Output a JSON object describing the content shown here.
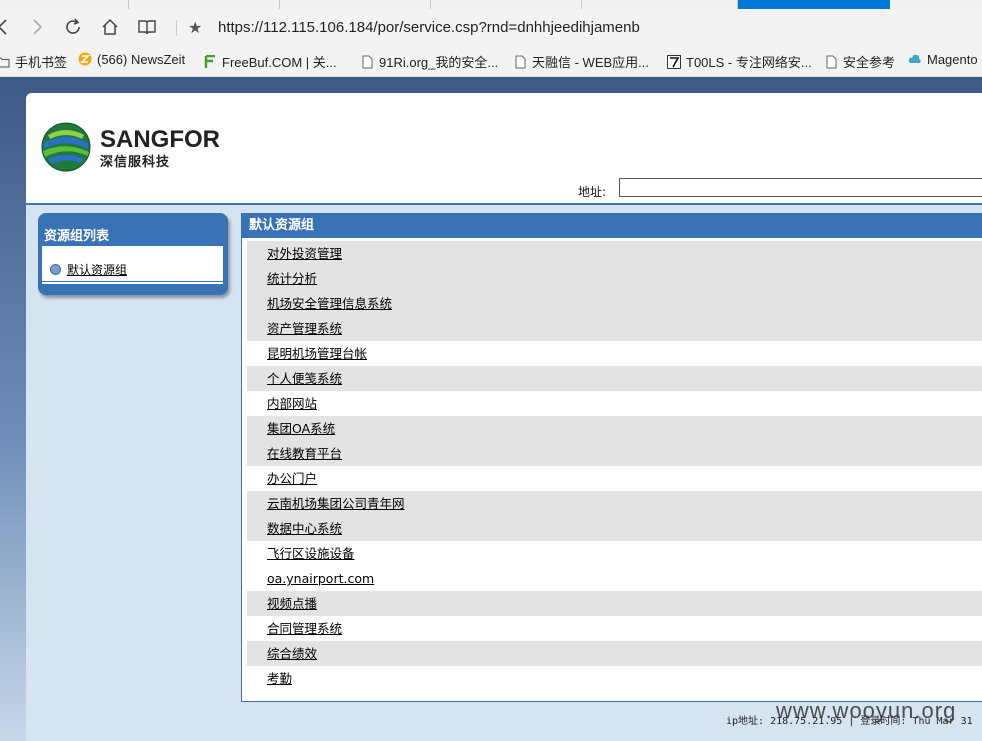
{
  "browser": {
    "url": "https://112.115.106.184/por/service.csp?rnd=dnhhjeedihjamenb",
    "bookmarks": [
      {
        "label": "手机书签",
        "icon": "folder-icon"
      },
      {
        "label": "(566) NewsZeit",
        "icon": "newszeit-icon"
      },
      {
        "label": "FreeBuf.COM | 关...",
        "icon": "freebuf-icon"
      },
      {
        "label": "91Ri.org_我的安全...",
        "icon": "page-icon"
      },
      {
        "label": "天融信 - WEB应用...",
        "icon": "page-icon"
      },
      {
        "label": "T00LS - 专注网络安...",
        "icon": "tools-icon"
      },
      {
        "label": "安全参考",
        "icon": "page-icon"
      },
      {
        "label": "Magento",
        "icon": "cloud-icon"
      }
    ]
  },
  "header": {
    "logo_text": "SANGFOR",
    "logo_sub": "深信服科技",
    "address_label": "地址:",
    "address_value": ""
  },
  "left_panel": {
    "title": "资源组列表",
    "items": [
      "默认资源组"
    ]
  },
  "right_panel": {
    "title": "默认资源组",
    "resources": [
      "对外投资管理",
      "统计分析",
      "机场安全管理信息系统",
      "资产管理系统",
      "昆明机场管理台帐",
      "个人便笺系统",
      "内部网站",
      "集团OA系统",
      "在线教育平台",
      "办公门户",
      "云南机场集团公司青年网",
      "数据中心系统",
      "飞行区设施设备",
      "oa.ynairport.com",
      "视频点播",
      "合同管理系统",
      "综合绩效",
      "考勤"
    ]
  },
  "footer": {
    "status": "ip地址: 218.75.21.95 | 登录时间: Thu Mar 31"
  },
  "watermark": "www.wooyun.org",
  "colors": {
    "accent": "#3a73b5",
    "panel_bg": "#d6e3f1",
    "row_shade": "#e3e3e3"
  }
}
